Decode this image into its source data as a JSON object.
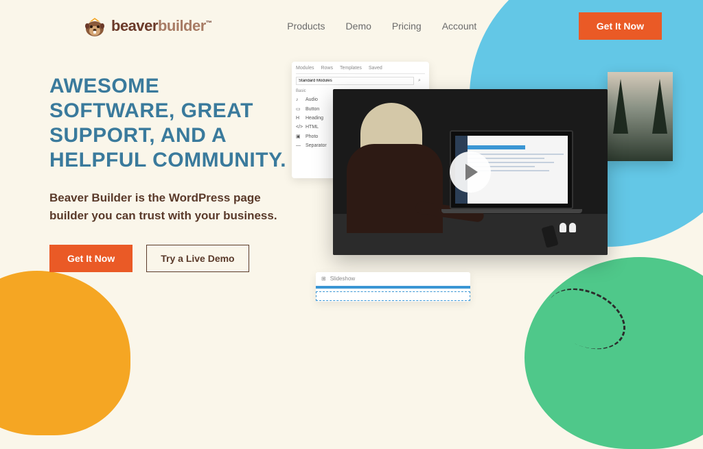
{
  "brand": {
    "name_part1": "beaver",
    "name_part2": "builder",
    "tm": "™"
  },
  "nav": {
    "links": [
      "Products",
      "Demo",
      "Pricing",
      "Account"
    ],
    "cta": "Get It Now"
  },
  "hero": {
    "title": "AWESOME SOFTWARE, GREAT SUPPORT, AND A HELPFUL COMMUNITY.",
    "subtitle": "Beaver Builder is the WordPress page builder you can trust with your business.",
    "primary_cta": "Get It Now",
    "secondary_cta": "Try a Live Demo"
  },
  "panel": {
    "tabs": [
      "Modules",
      "Rows",
      "Templates",
      "Saved"
    ],
    "dropdown": "Standard Modules",
    "section": "Basic",
    "items": [
      "Audio",
      "Button",
      "Heading",
      "HTML",
      "Photo",
      "Separator"
    ]
  },
  "module": {
    "label": "Slideshow"
  }
}
